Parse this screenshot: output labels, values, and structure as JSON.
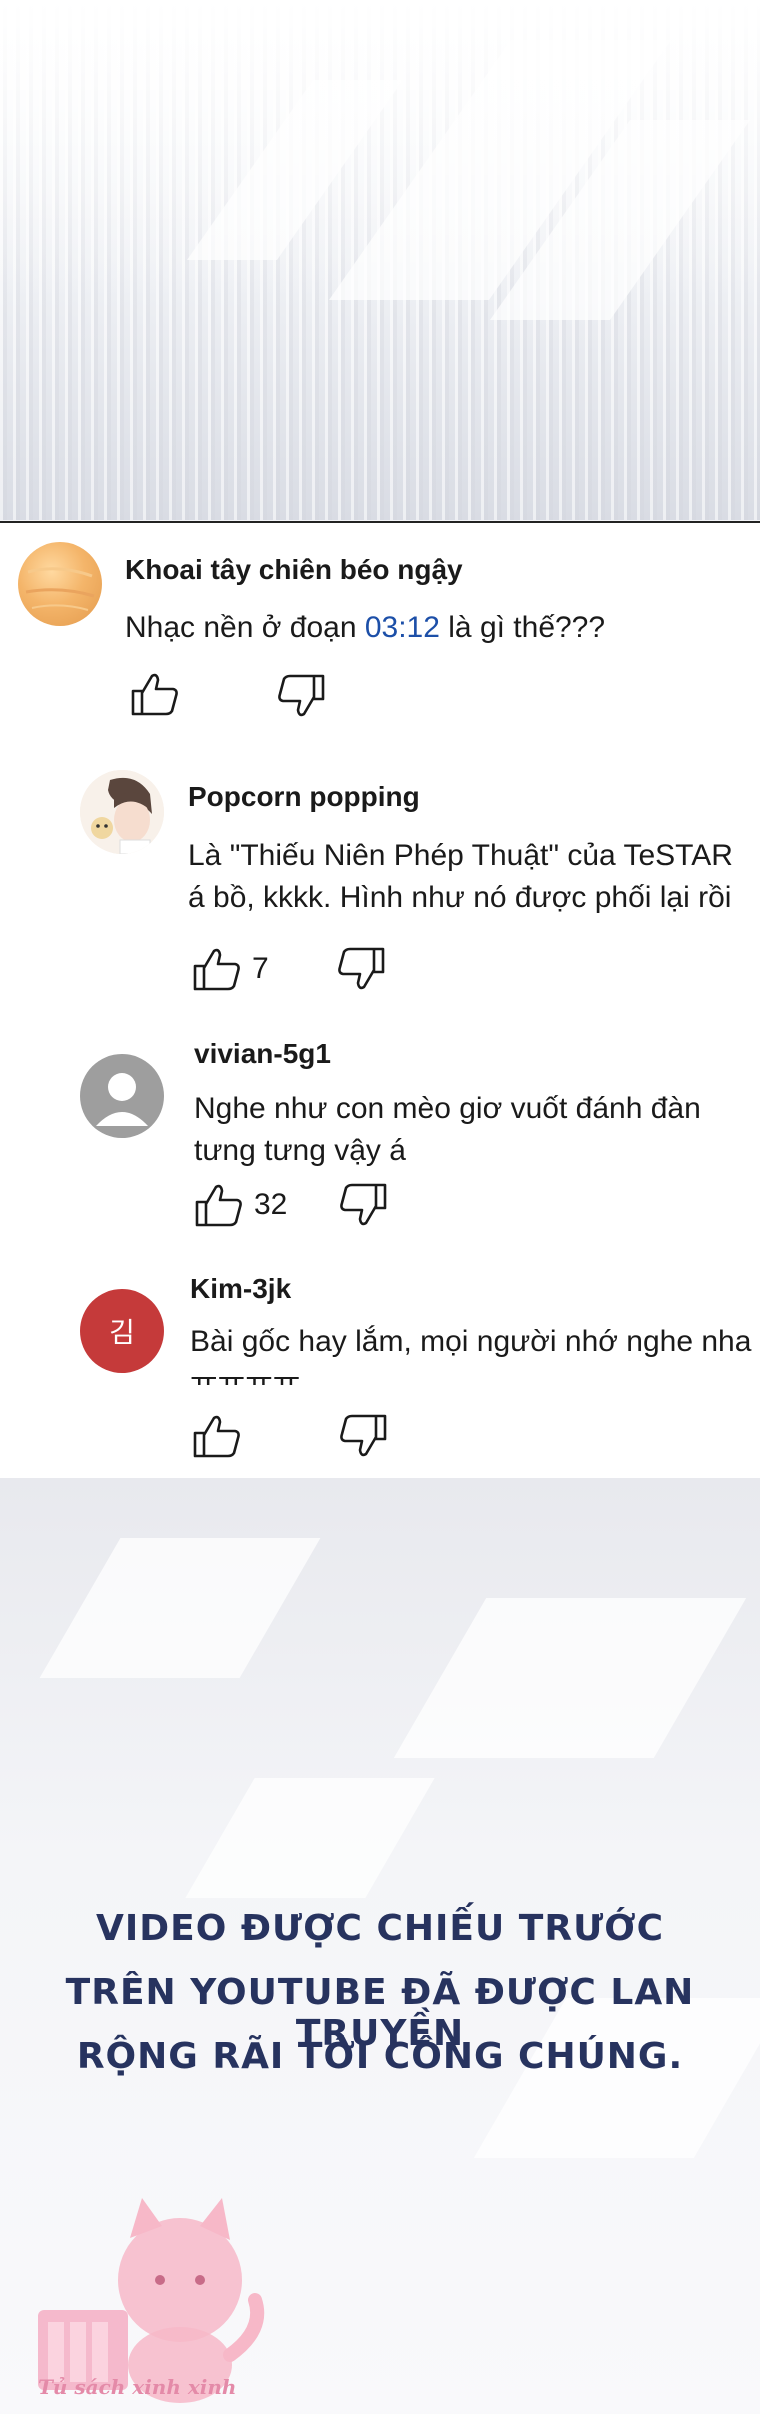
{
  "comments": [
    {
      "author": "Khoai tây chiên béo ngậy",
      "text_before": "Nhạc nền ở đoạn ",
      "timestamp": "03:12",
      "text_after": " là gì thế???",
      "likes": ""
    },
    {
      "author": "Popcorn popping",
      "line1": "Là \"Thiếu Niên Phép Thuật\" của TeSTAR",
      "line2": "á bồ, kkkk. Hình như nó được phối lại rồi",
      "likes": "7"
    },
    {
      "author": "vivian-5g1",
      "line1": "Nghe như con mèo giơ vuốt đánh đàn",
      "line2": "tưng tưng vậy á",
      "likes": "32"
    },
    {
      "author": "Kim-3jk",
      "avatar_letter": "김",
      "line1": "Bài gốc hay lắm, mọi người nhớ nghe nha",
      "line2": "ㅠㅠㅠㅠ",
      "likes": ""
    }
  ],
  "caption": {
    "line1": "VIDEO ĐƯỢC CHIẾU TRƯỚC",
    "line2": "TRÊN YOUTUBE ĐÃ ĐƯỢC LAN TRUYỀN",
    "line3": "RỘNG RÃI TỚI CÔNG CHÚNG."
  },
  "watermark": {
    "text": "Tủ sách xinh xinh"
  },
  "colors": {
    "timestamp": "#1c4fa8",
    "caption": "#27335f",
    "kim_avatar": "#c53a3a",
    "watermark": "#e48aa8"
  },
  "icons": [
    "thumbs-up-icon",
    "thumbs-down-icon"
  ]
}
